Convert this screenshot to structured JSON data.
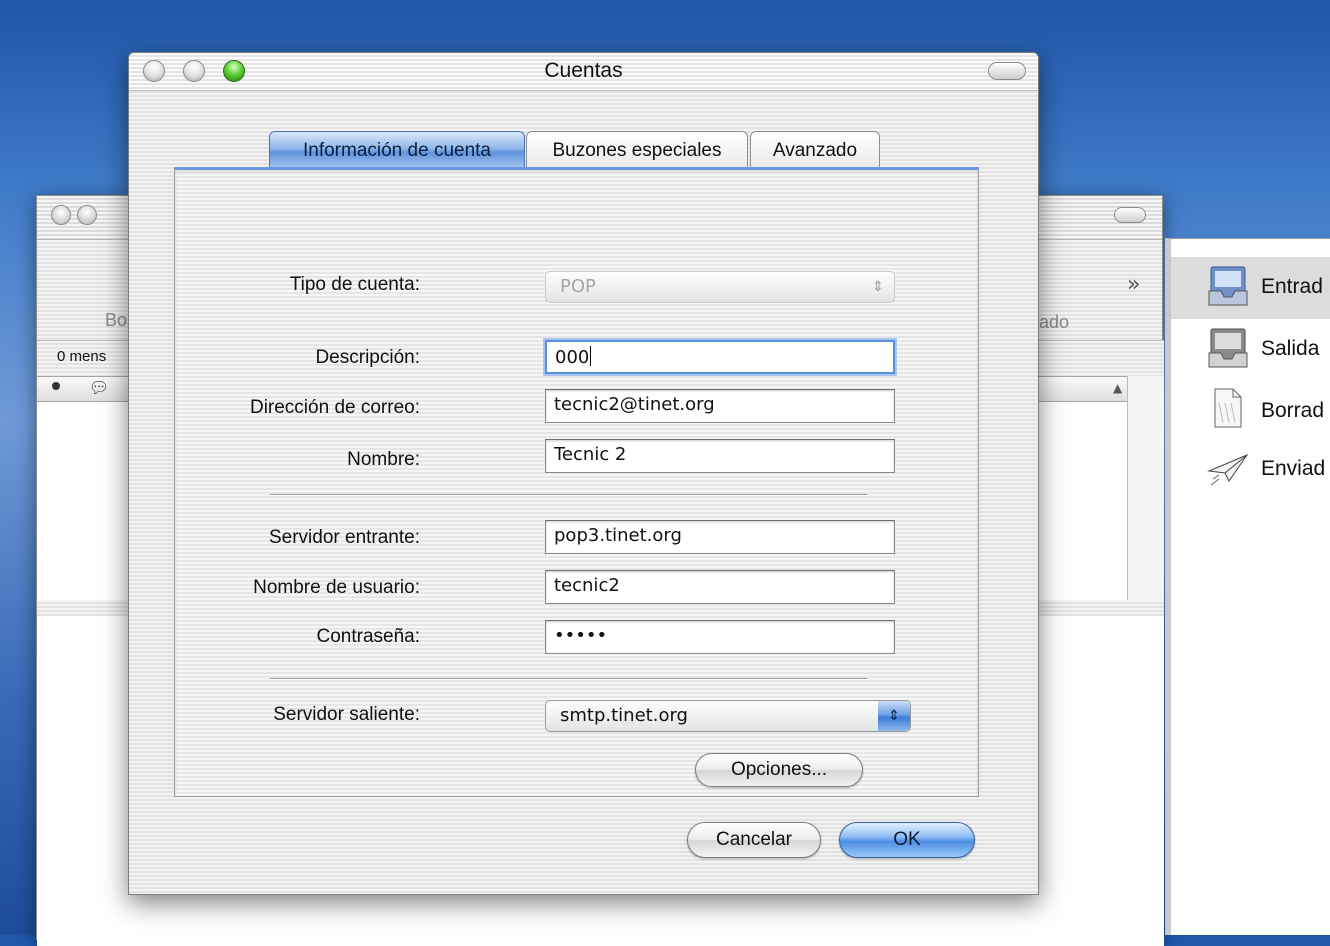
{
  "background_window": {
    "toolbar_partial_left": "Bo",
    "toolbar_partial_right": "eado",
    "chevrons": "»",
    "message_count": "0 mens"
  },
  "drawer": {
    "items": [
      {
        "label": "Entrad",
        "icon": "inbox-icon"
      },
      {
        "label": "Salida",
        "icon": "outbox-icon"
      },
      {
        "label": "Borrad",
        "icon": "drafts-icon"
      },
      {
        "label": "Enviad",
        "icon": "sent-icon"
      }
    ]
  },
  "dialog": {
    "title": "Cuentas",
    "tabs": [
      {
        "label": "Información de cuenta",
        "active": true
      },
      {
        "label": "Buzones especiales",
        "active": false
      },
      {
        "label": "Avanzado",
        "active": false
      }
    ],
    "fields": {
      "account_type": {
        "label": "Tipo de cuenta:",
        "value": "POP"
      },
      "description": {
        "label": "Descripción:",
        "value": "000"
      },
      "email": {
        "label": "Dirección de correo:",
        "value": "tecnic2@tinet.org"
      },
      "name": {
        "label": "Nombre:",
        "value": "Tecnic 2"
      },
      "incoming_server": {
        "label": "Servidor entrante:",
        "value": "pop3.tinet.org"
      },
      "username": {
        "label": "Nombre de usuario:",
        "value": "tecnic2"
      },
      "password": {
        "label": "Contraseña:",
        "value": "•••••"
      },
      "outgoing_server": {
        "label": "Servidor saliente:",
        "value": "smtp.tinet.org"
      }
    },
    "buttons": {
      "options": "Opciones...",
      "cancel": "Cancelar",
      "ok": "OK"
    }
  }
}
